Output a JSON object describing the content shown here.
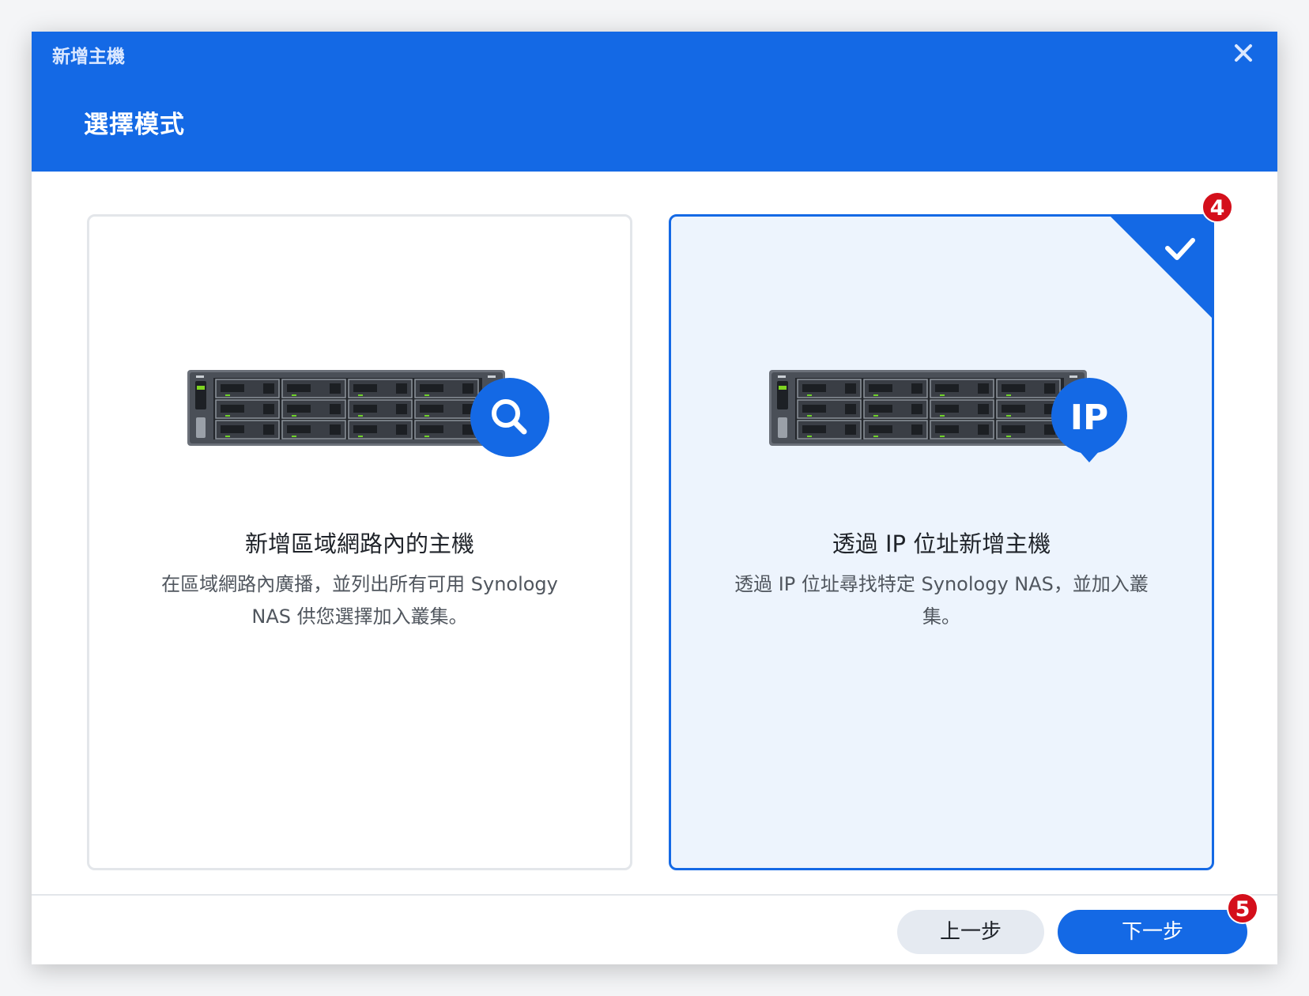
{
  "window": {
    "title": "新增主機",
    "close_icon": "close-icon"
  },
  "header": {
    "step_title": "選擇模式"
  },
  "options": [
    {
      "title": "新增區域網路內的主機",
      "description_line1": "在區域網路內廣播，並列出所有可用 Synology",
      "description_line2": "NAS 供您選擇加入叢集。",
      "icon": "search-icon",
      "selected": false
    },
    {
      "title": "透過 IP 位址新增主機",
      "description_line1": "透過 IP 位址尋找特定 Synology NAS，並加入叢",
      "description_line2": "集。",
      "icon": "ip-pin-icon",
      "badge_text": "IP",
      "selected": true
    }
  ],
  "footer": {
    "back_label": "上一步",
    "next_label": "下一步"
  },
  "annotations": {
    "badge_4": "4",
    "badge_5": "5"
  },
  "colors": {
    "accent": "#1469e5",
    "selected_bg": "#edf4fd",
    "annotation_badge": "#d40f1b"
  }
}
